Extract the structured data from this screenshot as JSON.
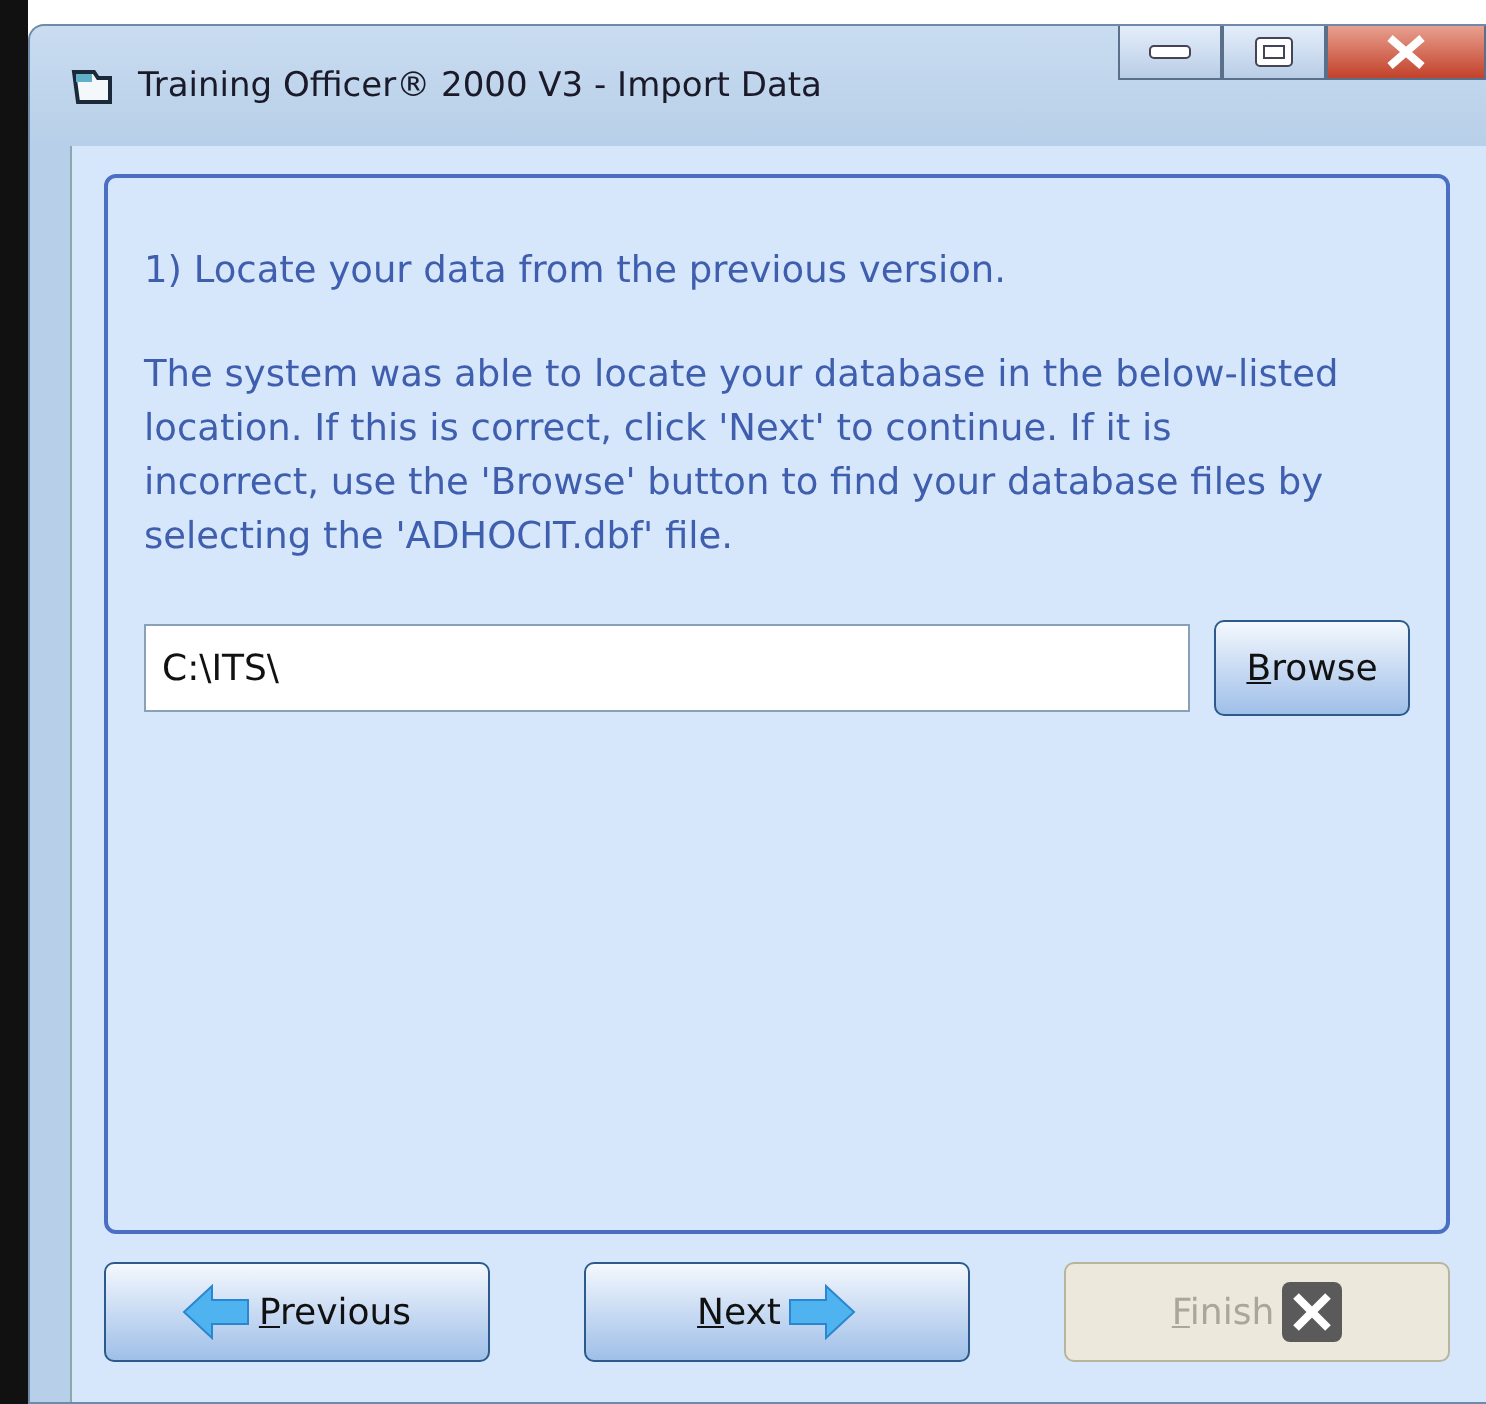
{
  "window": {
    "title": "Training Officer® 2000 V3 - Import Data"
  },
  "step": "1) Locate your data from the previous version.",
  "description": "The system was able to locate your database in the below-listed location. If this is correct, click 'Next' to continue. If it is incorrect, use the 'Browse' button to find your database files by selecting the 'ADHOCIT.dbf' file.",
  "path_field": {
    "value": "C:\\ITS\\"
  },
  "browse_button": {
    "label": "Browse"
  },
  "buttons": [
    {
      "kind": "previous",
      "label": "Previous",
      "disabled": false
    },
    {
      "kind": "next",
      "label": "Next",
      "disabled": false
    },
    {
      "kind": "finish",
      "label": "Finish",
      "disabled": true
    }
  ]
}
